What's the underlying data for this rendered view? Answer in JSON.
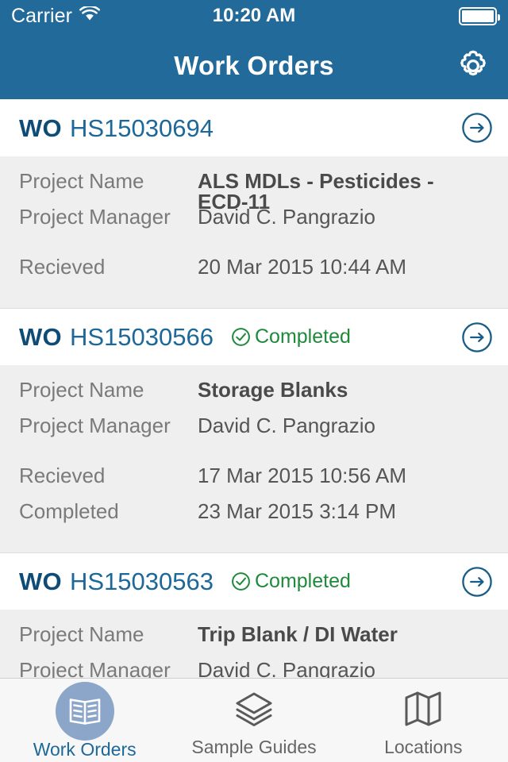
{
  "status_bar": {
    "carrier": "Carrier",
    "wifi_icon": "wifi-icon",
    "time": "10:20 AM",
    "battery_icon": "battery-full-icon"
  },
  "nav_bar": {
    "title": "Work Orders",
    "settings_icon": "gear-icon"
  },
  "colors": {
    "header_blue": "#226A99",
    "wo_prefix_blue": "#0E4C77",
    "wo_number_blue": "#1D6898",
    "completed_green": "#1F8A3B",
    "detail_bg": "#EFEFEF",
    "tab_active_circle": "#8CA6C9"
  },
  "labels": {
    "project_name": "Project Name",
    "project_manager": "Project Manager",
    "recieved": "Recieved",
    "completed": "Completed",
    "wo_prefix": "WO"
  },
  "work_orders": [
    {
      "prefix": "WO",
      "number": "HS15030694",
      "status": "",
      "has_status": false,
      "details": [
        {
          "label": "Project Name",
          "value": "ALS MDLs - Pesticides - ECD-11",
          "bold": true,
          "spaced": false
        },
        {
          "label": "Project Manager",
          "value": "David C. Pangrazio",
          "bold": false,
          "spaced": false
        },
        {
          "label": "Recieved",
          "value": "20 Mar 2015 10:44 AM",
          "bold": false,
          "spaced": true
        }
      ]
    },
    {
      "prefix": "WO",
      "number": "HS15030566",
      "status": "Completed",
      "has_status": true,
      "details": [
        {
          "label": "Project Name",
          "value": "Storage Blanks",
          "bold": true,
          "spaced": false
        },
        {
          "label": "Project Manager",
          "value": "David C. Pangrazio",
          "bold": false,
          "spaced": false
        },
        {
          "label": "Recieved",
          "value": "17 Mar 2015 10:56 AM",
          "bold": false,
          "spaced": true
        },
        {
          "label": "Completed",
          "value": "23 Mar 2015 3:14 PM",
          "bold": false,
          "spaced": false
        }
      ]
    },
    {
      "prefix": "WO",
      "number": "HS15030563",
      "status": "Completed",
      "has_status": true,
      "details": [
        {
          "label": "Project Name",
          "value": "Trip Blank / DI Water",
          "bold": true,
          "spaced": false
        },
        {
          "label": "Project Manager",
          "value": "David C. Pangrazio",
          "bold": false,
          "spaced": false
        }
      ]
    }
  ],
  "tab_bar": {
    "items": [
      {
        "label": "Work Orders",
        "icon": "open-book-icon",
        "active": true
      },
      {
        "label": "Sample Guides",
        "icon": "layers-icon",
        "active": false
      },
      {
        "label": "Locations",
        "icon": "map-icon",
        "active": false
      }
    ]
  }
}
